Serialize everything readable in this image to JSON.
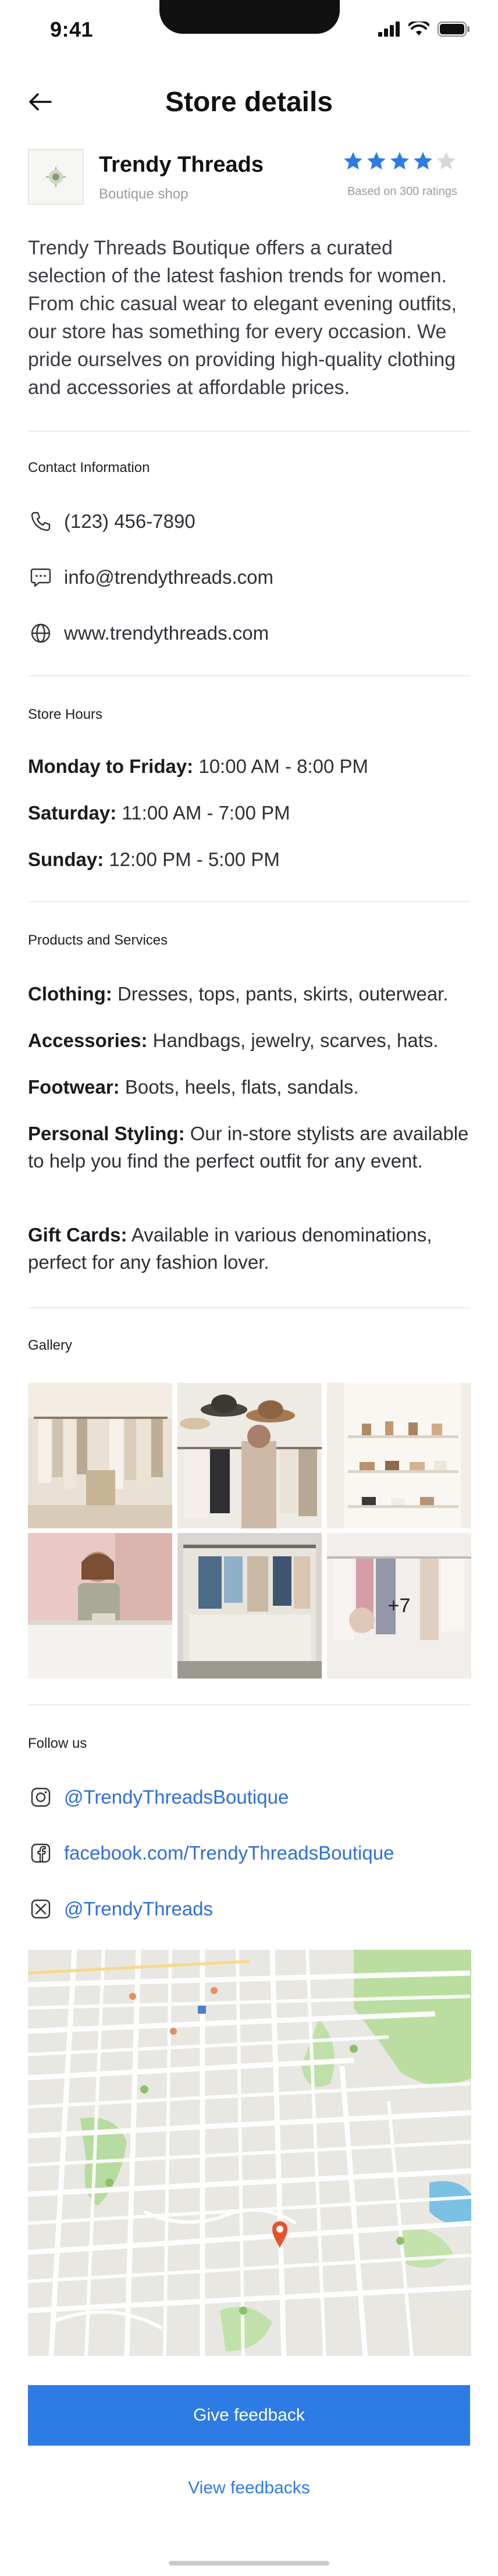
{
  "status_bar": {
    "time": "9:41"
  },
  "header": {
    "title": "Store details"
  },
  "store": {
    "name": "Trendy Threads",
    "type": "Boutique shop",
    "rating": 4,
    "rating_max": 5,
    "rating_caption": "Based on 300 ratings",
    "description": "Trendy Threads Boutique offers a curated selection of the latest fashion trends for women. From chic casual wear to elegant evening outfits, our store has something for every occasion. We pride ourselves on providing high-quality clothing and accessories at affordable prices."
  },
  "contact": {
    "title": "Contact Information",
    "phone": "(123) 456-7890",
    "email": "info@trendythreads.com",
    "website": "www.trendythreads.com"
  },
  "hours": {
    "title": "Store Hours",
    "rows": [
      {
        "label": "Monday to Friday:",
        "value": " 10:00 AM - 8:00 PM"
      },
      {
        "label": "Saturday:",
        "value": " 11:00 AM - 7:00 PM"
      },
      {
        "label": "Sunday:",
        "value": " 12:00 PM - 5:00 PM"
      }
    ]
  },
  "products": {
    "title": "Products and Services",
    "rows": [
      {
        "label": "Clothing:",
        "value": " Dresses, tops, pants, skirts, outerwear."
      },
      {
        "label": "Accessories:",
        "value": " Handbags, jewelry, scarves, hats."
      },
      {
        "label": "Footwear:",
        "value": " Boots, heels, flats, sandals."
      },
      {
        "label": "Personal Styling:",
        "value": " Our in-store stylists are available to help you find the perfect outfit for any event."
      },
      {
        "label": "Gift Cards:",
        "value": " Available in various denominations, perfect for any fashion lover."
      }
    ]
  },
  "gallery": {
    "title": "Gallery",
    "more_count": "+7"
  },
  "social": {
    "title": "Follow us",
    "instagram": "@TrendyThreadsBoutique",
    "facebook": "facebook.com/TrendyThreadsBoutique",
    "twitter": "@TrendyThreads"
  },
  "actions": {
    "give_feedback": "Give feedback",
    "view_feedbacks": "View feedbacks"
  },
  "colors": {
    "accent": "#2d7be5",
    "link": "#2f6fd6",
    "star_filled": "#2d7be5",
    "star_empty": "#d8d8dc",
    "map_pin": "#e5532d"
  }
}
